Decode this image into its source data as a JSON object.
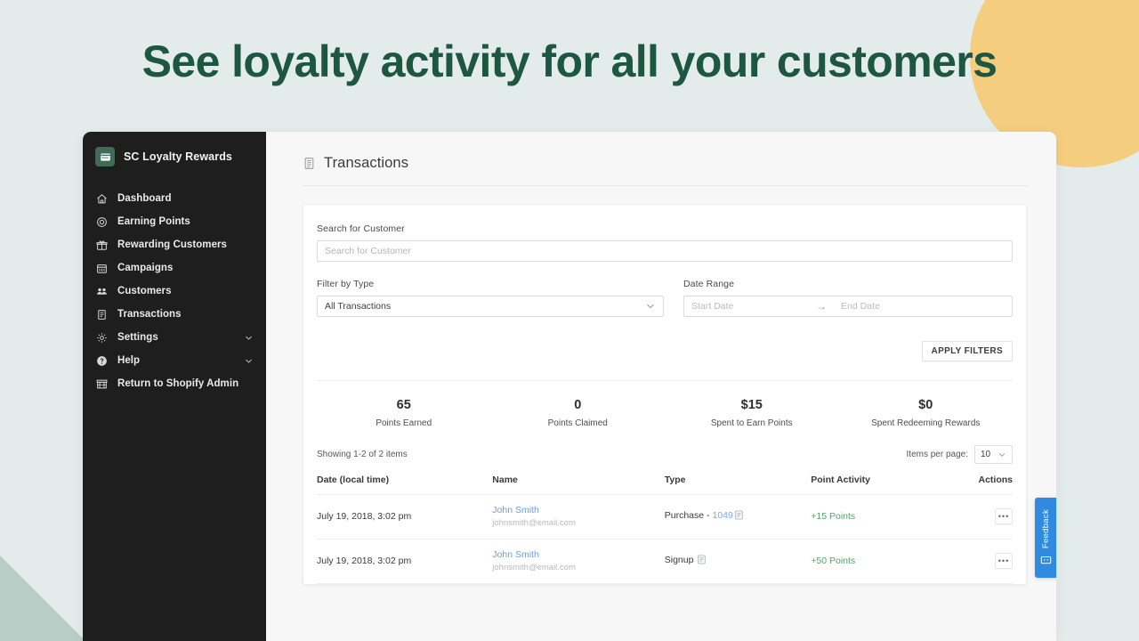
{
  "hero": {
    "title": "See loyalty activity for all your customers"
  },
  "theme": {
    "page_bg": "#e3ecea",
    "title_color": "#1d5741",
    "accent_circle": "#f5cd7f",
    "accent_triangle": "#b9cdc6",
    "sidebar_bg": "#1e1e1e",
    "link_blue": "#6b9fe0",
    "points_green": "#5a9e6f",
    "feedback_blue": "#2f8ae0"
  },
  "sidebar": {
    "brand": "SC Loyalty Rewards",
    "brand_icon": "card-icon",
    "items": [
      {
        "label": "Dashboard",
        "icon": "home-icon",
        "expandable": false
      },
      {
        "label": "Earning Points",
        "icon": "target-icon",
        "expandable": false
      },
      {
        "label": "Rewarding Customers",
        "icon": "gift-icon",
        "expandable": false
      },
      {
        "label": "Campaigns",
        "icon": "calendar-icon",
        "expandable": false
      },
      {
        "label": "Customers",
        "icon": "people-icon",
        "expandable": false
      },
      {
        "label": "Transactions",
        "icon": "document-icon",
        "expandable": false
      },
      {
        "label": "Settings",
        "icon": "gear-icon",
        "expandable": true
      },
      {
        "label": "Help",
        "icon": "help-circle-icon",
        "expandable": true
      },
      {
        "label": "Return to Shopify Admin",
        "icon": "store-icon",
        "expandable": false
      }
    ]
  },
  "page": {
    "title": "Transactions",
    "title_icon": "document-icon"
  },
  "filters": {
    "search_label": "Search for Customer",
    "search_value": "",
    "search_placeholder": "Search for Customer",
    "type_label": "Filter by Type",
    "type_value": "All Transactions",
    "date_label": "Date Range",
    "start_placeholder": "Start Date",
    "start_value": "",
    "end_placeholder": "End Date",
    "end_value": "",
    "range_arrow": "→",
    "apply_label": "APPLY FILTERS"
  },
  "stats": [
    {
      "value": "65",
      "label": "Points Earned"
    },
    {
      "value": "0",
      "label": "Points Claimed"
    },
    {
      "value": "$15",
      "label": "Spent to Earn Points"
    },
    {
      "value": "$0",
      "label": "Spent Redeeming Rewards"
    }
  ],
  "table_meta": {
    "showing": "Showing 1-2 of 2 items",
    "per_page_label": "Items per page:",
    "per_page_value": "10"
  },
  "table": {
    "headers": [
      "Date (local time)",
      "Name",
      "Type",
      "Point Activity",
      "Actions"
    ],
    "rows": [
      {
        "date": "July 19, 2018, 3:02 pm",
        "name": "John Smith",
        "email": "johnsmith@email.com",
        "type_prefix": "Purchase - ",
        "type_order": "1049",
        "points": "+15 Points",
        "action": "•••"
      },
      {
        "date": "July 19, 2018, 3:02 pm",
        "name": "John Smith",
        "email": "johnsmith@email.com",
        "type_prefix": "Signup ",
        "type_order": "",
        "points": "+50 Points",
        "action": "•••"
      }
    ]
  },
  "feedback": {
    "label": "Feedback",
    "icon": "chat-icon"
  }
}
